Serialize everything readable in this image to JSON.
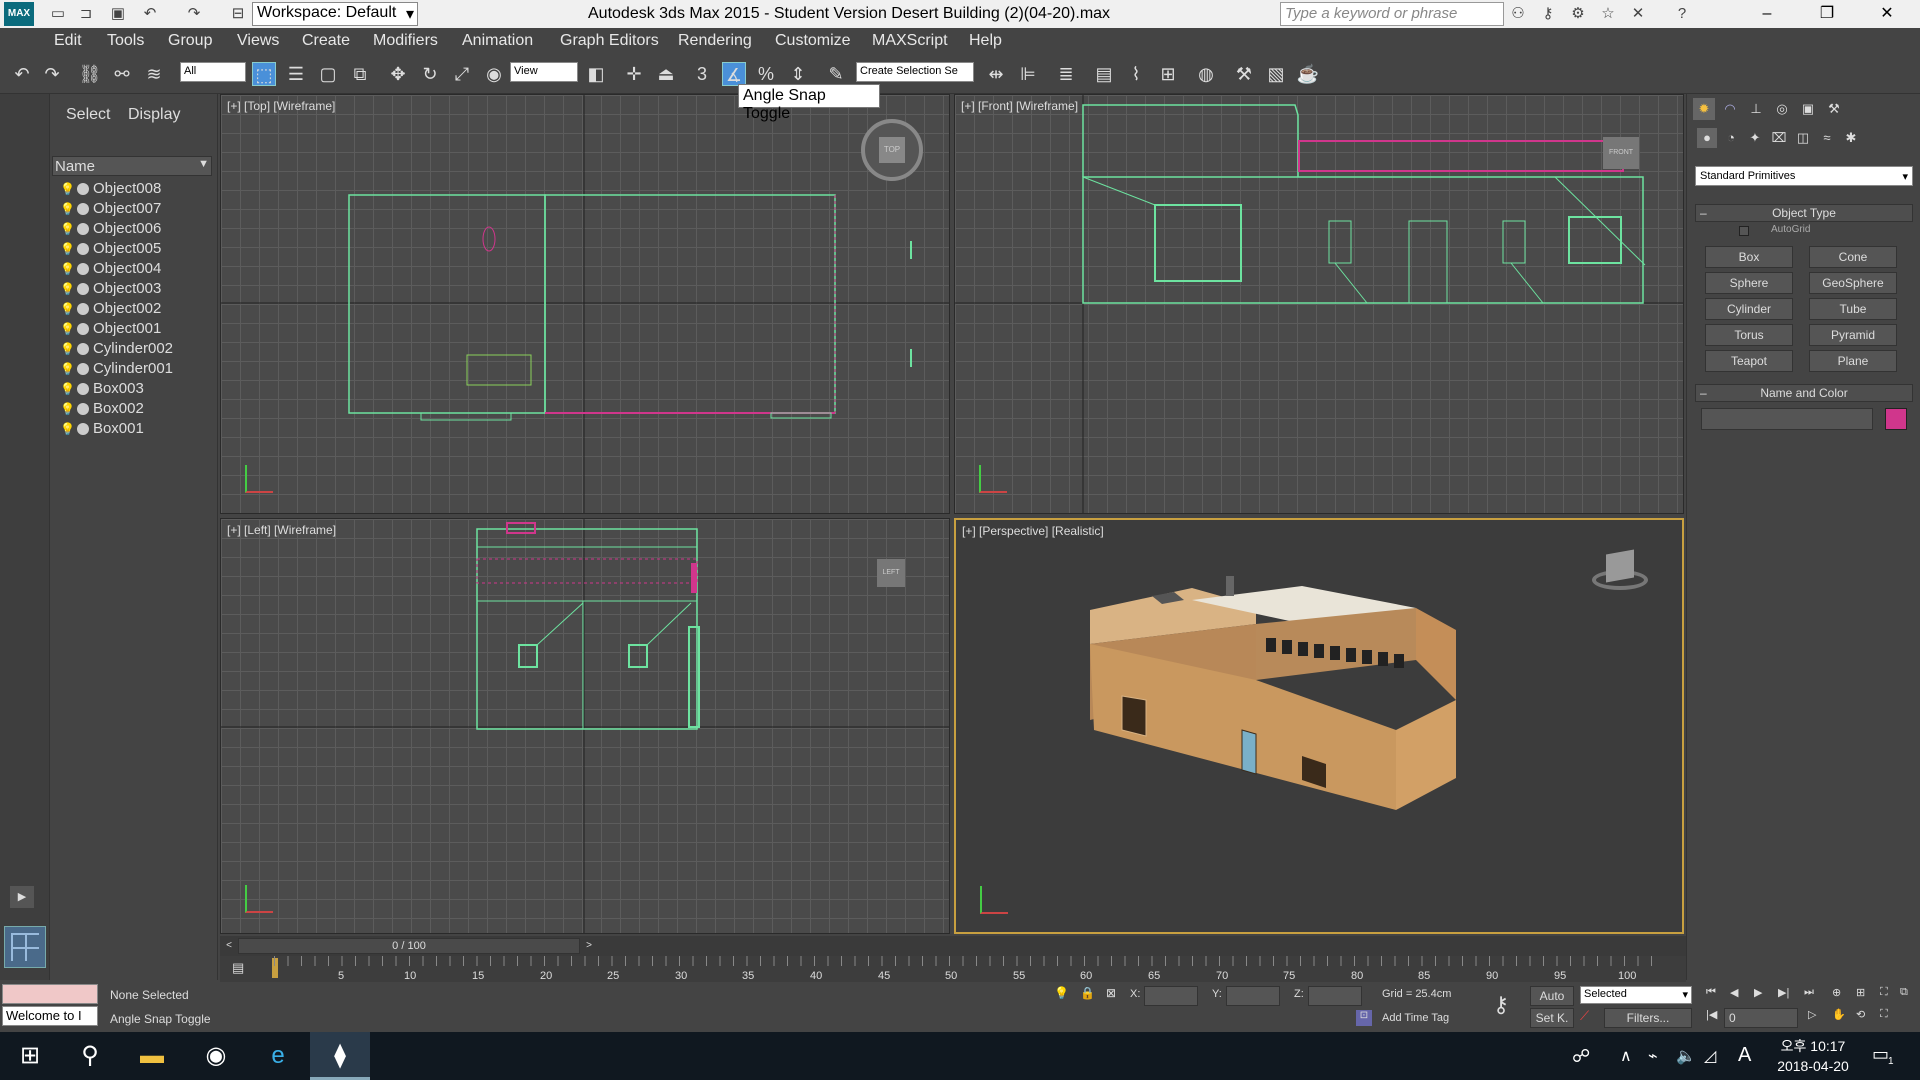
{
  "titlebar": {
    "workspace": "Workspace: Default",
    "title": "Autodesk 3ds Max  2015  - Student Version    Desert Building (2)(04-20).max",
    "search_placeholder": "Type a keyword or phrase"
  },
  "menu": [
    "Edit",
    "Tools",
    "Group",
    "Views",
    "Create",
    "Modifiers",
    "Animation",
    "Graph Editors",
    "Rendering",
    "Customize",
    "MAXScript",
    "Help"
  ],
  "toolbar": {
    "filter_select": "All",
    "coord_select": "View",
    "selection_set": "Create Selection Se",
    "snap_label": "3",
    "percent_label": "%",
    "tooltip": "Angle Snap Toggle"
  },
  "explorer": {
    "tabs": [
      "Select",
      "Display"
    ],
    "column": "Name",
    "objects": [
      "Object008",
      "Object007",
      "Object006",
      "Object005",
      "Object004",
      "Object003",
      "Object002",
      "Object001",
      "Cylinder002",
      "Cylinder001",
      "Box003",
      "Box002",
      "Box001"
    ]
  },
  "viewports": {
    "top": "[+] [Top] [Wireframe]",
    "front": "[+] [Front] [Wireframe]",
    "left": "[+] [Left] [Wireframe]",
    "perspective": "[+] [Perspective] [Realistic]",
    "cube_top": "TOP",
    "cube_front": "FRONT",
    "cube_left": "LEFT"
  },
  "command_panel": {
    "category": "Standard Primitives",
    "object_type_title": "Object Type",
    "autogrid": "AutoGrid",
    "buttons": [
      "Box",
      "Cone",
      "Sphere",
      "GeoSphere",
      "Cylinder",
      "Tube",
      "Torus",
      "Pyramid",
      "Teapot",
      "Plane"
    ],
    "name_color_title": "Name and Color",
    "name_value": "",
    "color": "#d0368c"
  },
  "timeline": {
    "frame": "0 / 100",
    "ticks": [
      "5",
      "10",
      "15",
      "20",
      "25",
      "30",
      "35",
      "40",
      "45",
      "50",
      "55",
      "60",
      "65",
      "70",
      "75",
      "80",
      "85",
      "90",
      "95",
      "100"
    ]
  },
  "status": {
    "selection": "None Selected",
    "prompt": "Angle Snap Toggle",
    "welcome": "Welcome to I",
    "x_label": "X:",
    "y_label": "Y:",
    "z_label": "Z:",
    "grid": "Grid = 25.4cm",
    "auto": "Auto",
    "set_key": "Set K.",
    "key_filter": "Selected",
    "filters": "Filters...",
    "add_time_tag": "Add Time Tag",
    "frame_value": "0"
  },
  "taskbar": {
    "ime": "A",
    "time": "오후 10:17",
    "date": "2018-04-20",
    "notifications": "1"
  }
}
